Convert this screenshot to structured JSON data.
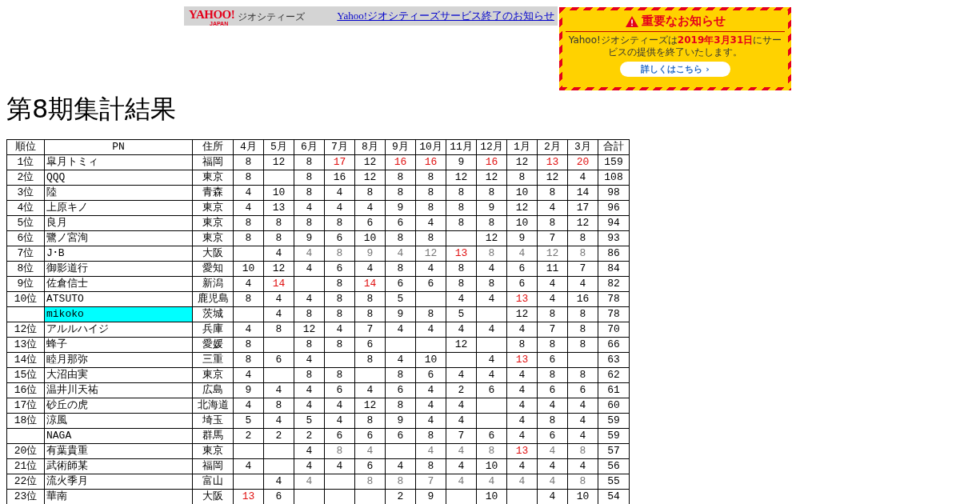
{
  "header_bar": {
    "logo": {
      "brand": "YAHOO!",
      "sub": "JAPAN",
      "service": "ジオシティーズ"
    },
    "link": "Yahoo!ジオシティーズサービス終了のお知らせ"
  },
  "notice": {
    "title": "重要なお知らせ",
    "message_before": "Yahoo!ジオシティーズは",
    "message_date": "2019年3月31日",
    "message_after": "にサービスの提供を終了いたします。",
    "button": "詳しくはこちら ›"
  },
  "title": "第8期集計結果",
  "table": {
    "columns": [
      "順位",
      "PN",
      "住所",
      "4月",
      "5月",
      "6月",
      "7月",
      "8月",
      "9月",
      "10月",
      "11月",
      "12月",
      "1月",
      "2月",
      "3月",
      "合計"
    ],
    "rows": [
      {
        "rank": "1位",
        "name": "皐月トミィ",
        "area": "福岡",
        "highlighted": false,
        "months": [
          {
            "text": "8",
            "color": "#000000"
          },
          {
            "text": "12",
            "color": "#000000"
          },
          {
            "text": "8",
            "color": "#000000"
          },
          {
            "text": "17",
            "color": "#e01010"
          },
          {
            "text": "12",
            "color": "#000000"
          },
          {
            "text": "16",
            "color": "#e01010"
          },
          {
            "text": "16",
            "color": "#e01010"
          },
          {
            "text": "9",
            "color": "#000000"
          },
          {
            "text": "16",
            "color": "#e01010"
          },
          {
            "text": "12",
            "color": "#000000"
          },
          {
            "text": "13",
            "color": "#e01010"
          },
          {
            "text": "20",
            "color": "#e01010"
          }
        ],
        "total": "159"
      },
      {
        "rank": "2位",
        "name": "QQQ",
        "area": "東京",
        "highlighted": false,
        "months": [
          {
            "text": "8",
            "color": "#000000"
          },
          {
            "blank": true
          },
          {
            "text": "8",
            "color": "#000000"
          },
          {
            "text": "16",
            "color": "#000000"
          },
          {
            "text": "12",
            "color": "#000000"
          },
          {
            "text": "8",
            "color": "#000000"
          },
          {
            "text": "8",
            "color": "#000000"
          },
          {
            "text": "12",
            "color": "#000000"
          },
          {
            "text": "12",
            "color": "#000000"
          },
          {
            "text": "8",
            "color": "#000000"
          },
          {
            "text": "12",
            "color": "#000000"
          },
          {
            "text": "4",
            "color": "#000000"
          }
        ],
        "total": "108"
      },
      {
        "rank": "3位",
        "name": "陸",
        "area": "青森",
        "highlighted": false,
        "months": [
          {
            "text": "4",
            "color": "#000000"
          },
          {
            "text": "10",
            "color": "#000000"
          },
          {
            "text": "8",
            "color": "#000000"
          },
          {
            "text": "4",
            "color": "#000000"
          },
          {
            "text": "8",
            "color": "#000000"
          },
          {
            "text": "8",
            "color": "#000000"
          },
          {
            "text": "8",
            "color": "#000000"
          },
          {
            "text": "8",
            "color": "#000000"
          },
          {
            "text": "8",
            "color": "#000000"
          },
          {
            "text": "10",
            "color": "#000000"
          },
          {
            "text": "8",
            "color": "#000000"
          },
          {
            "text": "14",
            "color": "#000000"
          }
        ],
        "total": "98"
      },
      {
        "rank": "4位",
        "name": "上原キノ",
        "area": "東京",
        "highlighted": false,
        "months": [
          {
            "text": "4",
            "color": "#000000"
          },
          {
            "text": "13",
            "color": "#000000"
          },
          {
            "text": "4",
            "color": "#000000"
          },
          {
            "text": "4",
            "color": "#000000"
          },
          {
            "text": "4",
            "color": "#000000"
          },
          {
            "text": "9",
            "color": "#000000"
          },
          {
            "text": "8",
            "color": "#000000"
          },
          {
            "text": "8",
            "color": "#000000"
          },
          {
            "text": "9",
            "color": "#000000"
          },
          {
            "text": "12",
            "color": "#000000"
          },
          {
            "text": "4",
            "color": "#000000"
          },
          {
            "text": "17",
            "color": "#000000"
          }
        ],
        "total": "96"
      },
      {
        "rank": "5位",
        "name": "良月",
        "area": "東京",
        "highlighted": false,
        "months": [
          {
            "text": "8",
            "color": "#000000"
          },
          {
            "text": "8",
            "color": "#000000"
          },
          {
            "text": "8",
            "color": "#000000"
          },
          {
            "text": "8",
            "color": "#000000"
          },
          {
            "text": "6",
            "color": "#000000"
          },
          {
            "text": "6",
            "color": "#000000"
          },
          {
            "text": "4",
            "color": "#000000"
          },
          {
            "text": "8",
            "color": "#000000"
          },
          {
            "text": "8",
            "color": "#000000"
          },
          {
            "text": "10",
            "color": "#000000"
          },
          {
            "text": "8",
            "color": "#000000"
          },
          {
            "text": "12",
            "color": "#000000"
          }
        ],
        "total": "94"
      },
      {
        "rank": "6位",
        "name": "鷺ノ宮洵",
        "area": "東京",
        "highlighted": false,
        "months": [
          {
            "text": "8",
            "color": "#000000"
          },
          {
            "text": "8",
            "color": "#000000"
          },
          {
            "text": "9",
            "color": "#000000"
          },
          {
            "text": "6",
            "color": "#000000"
          },
          {
            "text": "10",
            "color": "#000000"
          },
          {
            "text": "8",
            "color": "#000000"
          },
          {
            "text": "8",
            "color": "#000000"
          },
          {
            "blank": true
          },
          {
            "text": "12",
            "color": "#000000"
          },
          {
            "text": "9",
            "color": "#000000"
          },
          {
            "text": "7",
            "color": "#000000"
          },
          {
            "text": "8",
            "color": "#000000"
          }
        ],
        "total": "93"
      },
      {
        "rank": "7位",
        "name": "J･B",
        "area": "大阪",
        "highlighted": false,
        "months": [
          {
            "blank": true
          },
          {
            "text": "4",
            "color": "#000000"
          },
          {
            "text": "4",
            "color": "#777777"
          },
          {
            "text": "8",
            "color": "#777777"
          },
          {
            "text": "9",
            "color": "#777777"
          },
          {
            "text": "4",
            "color": "#777777"
          },
          {
            "text": "12",
            "color": "#777777"
          },
          {
            "text": "13",
            "color": "#e01010"
          },
          {
            "text": "8",
            "color": "#777777"
          },
          {
            "text": "4",
            "color": "#777777"
          },
          {
            "text": "12",
            "color": "#777777"
          },
          {
            "text": "8",
            "color": "#777777"
          }
        ],
        "total": "86"
      },
      {
        "rank": "8位",
        "name": "御影道行",
        "area": "愛知",
        "highlighted": false,
        "months": [
          {
            "text": "10",
            "color": "#000000"
          },
          {
            "text": "12",
            "color": "#000000"
          },
          {
            "text": "4",
            "color": "#000000"
          },
          {
            "text": "6",
            "color": "#000000"
          },
          {
            "text": "4",
            "color": "#000000"
          },
          {
            "text": "8",
            "color": "#000000"
          },
          {
            "text": "4",
            "color": "#000000"
          },
          {
            "text": "8",
            "color": "#000000"
          },
          {
            "text": "4",
            "color": "#000000"
          },
          {
            "text": "6",
            "color": "#000000"
          },
          {
            "text": "11",
            "color": "#000000"
          },
          {
            "text": "7",
            "color": "#000000"
          }
        ],
        "total": "84"
      },
      {
        "rank": "9位",
        "name": "佐倉信士",
        "area": "新潟",
        "highlighted": false,
        "months": [
          {
            "text": "4",
            "color": "#000000"
          },
          {
            "text": "14",
            "color": "#e01010"
          },
          {
            "blank": true
          },
          {
            "text": "8",
            "color": "#000000"
          },
          {
            "text": "14",
            "color": "#e01010"
          },
          {
            "text": "6",
            "color": "#000000"
          },
          {
            "text": "6",
            "color": "#000000"
          },
          {
            "text": "8",
            "color": "#000000"
          },
          {
            "text": "8",
            "color": "#000000"
          },
          {
            "text": "6",
            "color": "#000000"
          },
          {
            "text": "4",
            "color": "#000000"
          },
          {
            "text": "4",
            "color": "#000000"
          }
        ],
        "total": "82"
      },
      {
        "rank": "10位",
        "name": "ATSUTO",
        "area": "鹿児島",
        "highlighted": false,
        "months": [
          {
            "text": "8",
            "color": "#000000"
          },
          {
            "text": "4",
            "color": "#000000"
          },
          {
            "text": "4",
            "color": "#000000"
          },
          {
            "text": "8",
            "color": "#000000"
          },
          {
            "text": "8",
            "color": "#000000"
          },
          {
            "text": "5",
            "color": "#000000"
          },
          {
            "blank": true
          },
          {
            "text": "4",
            "color": "#000000"
          },
          {
            "text": "4",
            "color": "#000000"
          },
          {
            "text": "13",
            "color": "#e01010"
          },
          {
            "text": "4",
            "color": "#000000"
          },
          {
            "text": "16",
            "color": "#000000"
          }
        ],
        "total": "78"
      },
      {
        "name": "mikoko",
        "area": "茨城",
        "highlighted": true,
        "months": [
          {
            "blank": true
          },
          {
            "text": "4",
            "color": "#000000"
          },
          {
            "text": "8",
            "color": "#000000"
          },
          {
            "text": "8",
            "color": "#000000"
          },
          {
            "text": "8",
            "color": "#000000"
          },
          {
            "text": "9",
            "color": "#000000"
          },
          {
            "text": "8",
            "color": "#000000"
          },
          {
            "text": "5",
            "color": "#000000"
          },
          {
            "blank": true
          },
          {
            "text": "12",
            "color": "#000000"
          },
          {
            "text": "8",
            "color": "#000000"
          },
          {
            "text": "8",
            "color": "#000000"
          }
        ],
        "total": "78"
      },
      {
        "rank": "12位",
        "name": "アルルハイジ",
        "area": "兵庫",
        "highlighted": false,
        "months": [
          {
            "text": "4",
            "color": "#000000"
          },
          {
            "text": "8",
            "color": "#000000"
          },
          {
            "text": "12",
            "color": "#000000"
          },
          {
            "text": "4",
            "color": "#000000"
          },
          {
            "text": "7",
            "color": "#000000"
          },
          {
            "text": "4",
            "color": "#000000"
          },
          {
            "text": "4",
            "color": "#000000"
          },
          {
            "text": "4",
            "color": "#000000"
          },
          {
            "text": "4",
            "color": "#000000"
          },
          {
            "text": "4",
            "color": "#000000"
          },
          {
            "text": "7",
            "color": "#000000"
          },
          {
            "text": "8",
            "color": "#000000"
          }
        ],
        "total": "70"
      },
      {
        "rank": "13位",
        "name": "蜂子",
        "area": "愛媛",
        "highlighted": false,
        "months": [
          {
            "text": "8",
            "color": "#000000"
          },
          {
            "blank": true
          },
          {
            "text": "8",
            "color": "#000000"
          },
          {
            "text": "8",
            "color": "#000000"
          },
          {
            "text": "6",
            "color": "#000000"
          },
          {
            "blank": true
          },
          {
            "blank": true
          },
          {
            "text": "12",
            "color": "#000000"
          },
          {
            "blank": true
          },
          {
            "text": "8",
            "color": "#000000"
          },
          {
            "text": "8",
            "color": "#000000"
          },
          {
            "text": "8",
            "color": "#000000"
          }
        ],
        "total": "66"
      },
      {
        "rank": "14位",
        "name": "睦月那弥",
        "area": "三重",
        "highlighted": false,
        "months": [
          {
            "text": "8",
            "color": "#000000"
          },
          {
            "text": "6",
            "color": "#000000"
          },
          {
            "text": "4",
            "color": "#000000"
          },
          {
            "blank": true
          },
          {
            "text": "8",
            "color": "#000000"
          },
          {
            "text": "4",
            "color": "#000000"
          },
          {
            "text": "10",
            "color": "#000000"
          },
          {
            "blank": true
          },
          {
            "text": "4",
            "color": "#000000"
          },
          {
            "text": "13",
            "color": "#e01010"
          },
          {
            "text": "6",
            "color": "#000000"
          },
          {
            "blank": true
          }
        ],
        "total": "63"
      },
      {
        "rank": "15位",
        "name": "大沼由実",
        "area": "東京",
        "highlighted": false,
        "months": [
          {
            "text": "4",
            "color": "#000000"
          },
          {
            "blank": true
          },
          {
            "text": "8",
            "color": "#000000"
          },
          {
            "text": "8",
            "color": "#000000"
          },
          {
            "blank": true
          },
          {
            "text": "8",
            "color": "#000000"
          },
          {
            "text": "6",
            "color": "#000000"
          },
          {
            "text": "4",
            "color": "#000000"
          },
          {
            "text": "4",
            "color": "#000000"
          },
          {
            "text": "4",
            "color": "#000000"
          },
          {
            "text": "8",
            "color": "#000000"
          },
          {
            "text": "8",
            "color": "#000000"
          }
        ],
        "total": "62"
      },
      {
        "rank": "16位",
        "name": "温井川天祐",
        "area": "広島",
        "highlighted": false,
        "months": [
          {
            "text": "9",
            "color": "#000000"
          },
          {
            "text": "4",
            "color": "#000000"
          },
          {
            "text": "4",
            "color": "#000000"
          },
          {
            "text": "6",
            "color": "#000000"
          },
          {
            "text": "4",
            "color": "#000000"
          },
          {
            "text": "6",
            "color": "#000000"
          },
          {
            "text": "4",
            "color": "#000000"
          },
          {
            "text": "2",
            "color": "#000000"
          },
          {
            "text": "6",
            "color": "#000000"
          },
          {
            "text": "4",
            "color": "#000000"
          },
          {
            "text": "6",
            "color": "#000000"
          },
          {
            "text": "6",
            "color": "#000000"
          }
        ],
        "total": "61"
      },
      {
        "rank": "17位",
        "name": "砂丘の虎",
        "area": "北海道",
        "highlighted": false,
        "months": [
          {
            "text": "4",
            "color": "#000000"
          },
          {
            "text": "8",
            "color": "#000000"
          },
          {
            "text": "4",
            "color": "#000000"
          },
          {
            "text": "4",
            "color": "#000000"
          },
          {
            "text": "12",
            "color": "#000000"
          },
          {
            "text": "8",
            "color": "#000000"
          },
          {
            "text": "4",
            "color": "#000000"
          },
          {
            "text": "4",
            "color": "#000000"
          },
          {
            "blank": true
          },
          {
            "text": "4",
            "color": "#000000"
          },
          {
            "text": "4",
            "color": "#000000"
          },
          {
            "text": "4",
            "color": "#000000"
          }
        ],
        "total": "60"
      },
      {
        "rank": "18位",
        "name": "涼風",
        "area": "埼玉",
        "highlighted": false,
        "months": [
          {
            "text": "5",
            "color": "#000000"
          },
          {
            "text": "4",
            "color": "#000000"
          },
          {
            "text": "5",
            "color": "#000000"
          },
          {
            "text": "4",
            "color": "#000000"
          },
          {
            "text": "8",
            "color": "#000000"
          },
          {
            "text": "9",
            "color": "#000000"
          },
          {
            "text": "4",
            "color": "#000000"
          },
          {
            "text": "4",
            "color": "#000000"
          },
          {
            "blank": true
          },
          {
            "text": "4",
            "color": "#000000"
          },
          {
            "text": "8",
            "color": "#000000"
          },
          {
            "text": "4",
            "color": "#000000"
          }
        ],
        "total": "59"
      },
      {
        "name": "NAGA",
        "area": "群馬",
        "highlighted": false,
        "months": [
          {
            "text": "2",
            "color": "#000000"
          },
          {
            "text": "2",
            "color": "#000000"
          },
          {
            "text": "2",
            "color": "#000000"
          },
          {
            "text": "6",
            "color": "#000000"
          },
          {
            "text": "6",
            "color": "#000000"
          },
          {
            "text": "6",
            "color": "#000000"
          },
          {
            "text": "8",
            "color": "#000000"
          },
          {
            "text": "7",
            "color": "#000000"
          },
          {
            "text": "6",
            "color": "#000000"
          },
          {
            "text": "4",
            "color": "#000000"
          },
          {
            "text": "6",
            "color": "#000000"
          },
          {
            "text": "4",
            "color": "#000000"
          }
        ],
        "total": "59"
      },
      {
        "rank": "20位",
        "name": "有葉貴重",
        "area": "東京",
        "highlighted": false,
        "months": [
          {
            "blank": true
          },
          {
            "blank": true
          },
          {
            "text": "4",
            "color": "#000000"
          },
          {
            "text": "8",
            "color": "#777777"
          },
          {
            "text": "4",
            "color": "#777777"
          },
          {
            "blank": true
          },
          {
            "text": "4",
            "color": "#777777"
          },
          {
            "text": "4",
            "color": "#777777"
          },
          {
            "text": "8",
            "color": "#777777"
          },
          {
            "text": "13",
            "color": "#e01010"
          },
          {
            "text": "4",
            "color": "#777777"
          },
          {
            "text": "8",
            "color": "#777777"
          }
        ],
        "total": "57"
      },
      {
        "rank": "21位",
        "name": "武術師某",
        "area": "福岡",
        "highlighted": false,
        "months": [
          {
            "text": "4",
            "color": "#000000"
          },
          {
            "blank": true
          },
          {
            "text": "4",
            "color": "#000000"
          },
          {
            "text": "4",
            "color": "#000000"
          },
          {
            "text": "6",
            "color": "#000000"
          },
          {
            "text": "4",
            "color": "#000000"
          },
          {
            "text": "8",
            "color": "#000000"
          },
          {
            "text": "4",
            "color": "#000000"
          },
          {
            "text": "10",
            "color": "#000000"
          },
          {
            "text": "4",
            "color": "#000000"
          },
          {
            "text": "4",
            "color": "#000000"
          },
          {
            "text": "4",
            "color": "#000000"
          }
        ],
        "total": "56"
      },
      {
        "rank": "22位",
        "name": "流火季月",
        "area": "富山",
        "highlighted": false,
        "months": [
          {
            "blank": true
          },
          {
            "text": "4",
            "color": "#000000"
          },
          {
            "text": "4",
            "color": "#777777"
          },
          {
            "blank": true
          },
          {
            "text": "8",
            "color": "#777777"
          },
          {
            "text": "8",
            "color": "#777777"
          },
          {
            "text": "7",
            "color": "#777777"
          },
          {
            "text": "4",
            "color": "#777777"
          },
          {
            "text": "4",
            "color": "#777777"
          },
          {
            "text": "4",
            "color": "#777777"
          },
          {
            "text": "4",
            "color": "#777777"
          },
          {
            "text": "8",
            "color": "#777777"
          }
        ],
        "total": "55"
      },
      {
        "rank": "23位",
        "name": "華南",
        "area": "大阪",
        "highlighted": false,
        "months": [
          {
            "text": "13",
            "color": "#e01010"
          },
          {
            "text": "6",
            "color": "#000000"
          },
          {
            "blank": true
          },
          {
            "blank": true
          },
          {
            "blank": true
          },
          {
            "text": "2",
            "color": "#000000"
          },
          {
            "text": "9",
            "color": "#000000"
          },
          {
            "blank": true
          },
          {
            "text": "10",
            "color": "#000000"
          },
          {
            "blank": true
          },
          {
            "text": "4",
            "color": "#000000"
          },
          {
            "text": "10",
            "color": "#000000"
          }
        ],
        "total": "54"
      }
    ]
  }
}
